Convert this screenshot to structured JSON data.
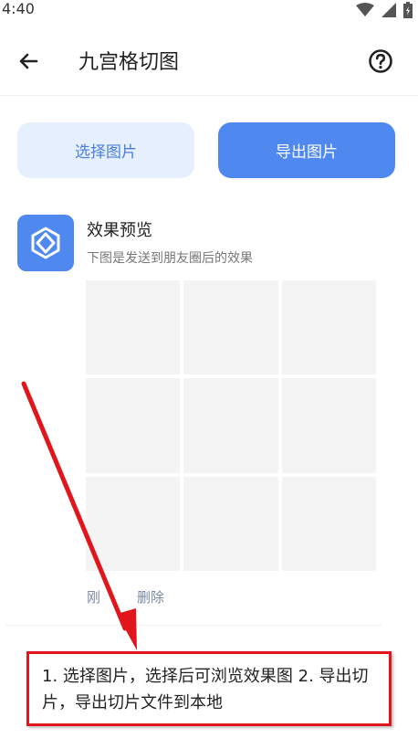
{
  "status_bar": {
    "time": "4:40"
  },
  "app_bar": {
    "title": "九宫格切图"
  },
  "buttons": {
    "select": "选择图片",
    "export": "导出图片"
  },
  "preview": {
    "title": "效果预览",
    "subtitle": "下图是发送到朋友圈后的效果"
  },
  "actions": {
    "left": "刚",
    "delete": "删除"
  },
  "annotation": {
    "text": "1. 选择图片，选择后可浏览效果图 2. 导出切片，导出切片文件到本地"
  },
  "colors": {
    "accent": "#4f89f0",
    "annotation_red": "#e0161c"
  }
}
